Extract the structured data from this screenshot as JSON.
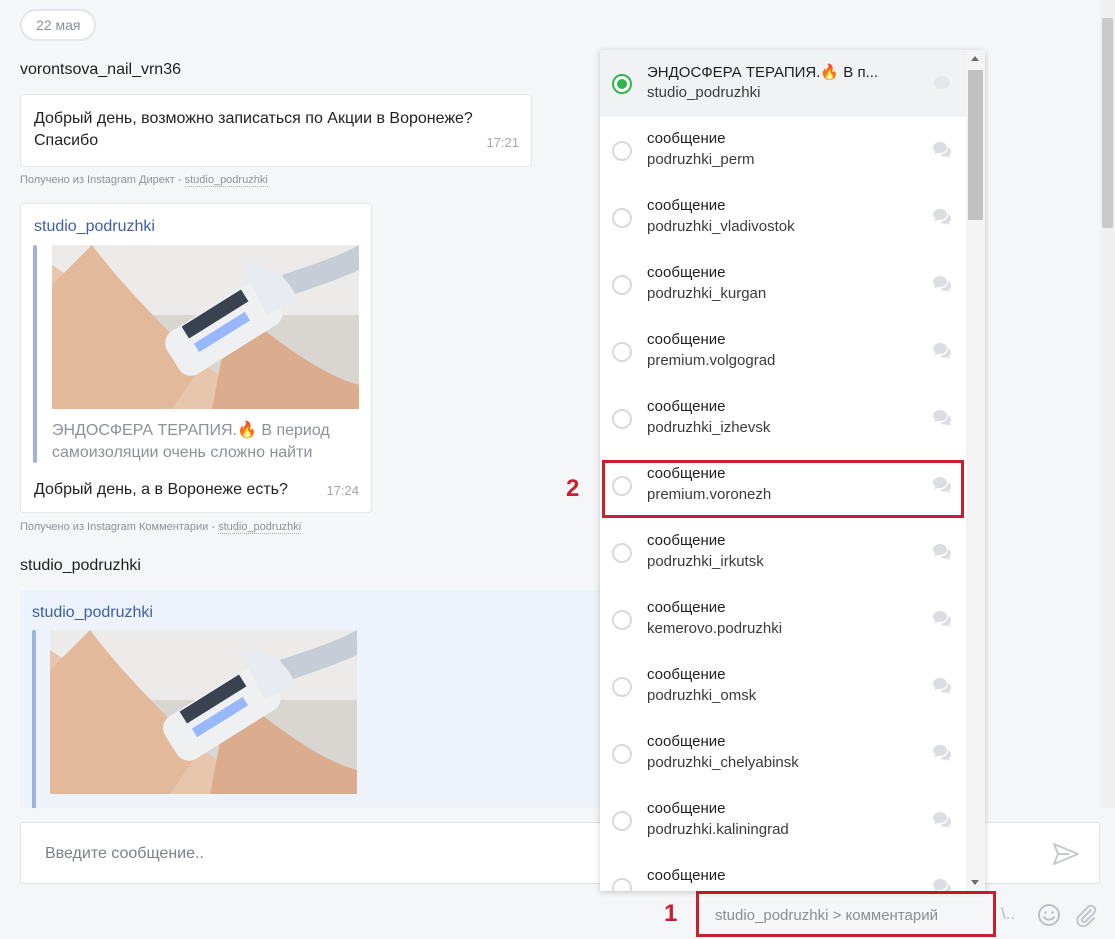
{
  "chat": {
    "date": "22 мая",
    "msg1": {
      "sender": "vorontsova_nail_vrn36",
      "text": "Добрый день, возможно записаться по Акции в Воронеже? Спасибо",
      "time": "17:21",
      "source_prefix": "Получено из Instagram Директ - ",
      "source_channel": "studio_podruzhki"
    },
    "msg2": {
      "quote_author": "studio_podruzhki",
      "quote_text": "ЭНДОСФЕРА ТЕРАПИЯ.🔥 В период самоизоляции очень сложно найти",
      "text": "Добрый день, а в Воронеже есть?",
      "time": "17:24",
      "source_prefix": "Получено из Instagram Комментарии - ",
      "source_channel": "studio_podruzhki"
    },
    "msg3": {
      "sender": "studio_podruzhki",
      "quote_author": "studio_podruzhki"
    }
  },
  "composer": {
    "placeholder": "Введите сообщение.."
  },
  "footer": {
    "channel": "studio_podruzhki > комментарий",
    "annotation": "1"
  },
  "dropdown": {
    "annotation": "2",
    "items": [
      {
        "title": "ЭНДОСФЕРА ТЕРАПИЯ.🔥 В п...",
        "sub": "studio_podruzhki",
        "selected": true
      },
      {
        "title": "сообщение",
        "sub": "podruzhki_perm",
        "selected": false
      },
      {
        "title": "сообщение",
        "sub": "podruzhki_vladivostok",
        "selected": false
      },
      {
        "title": "сообщение",
        "sub": "podruzhki_kurgan",
        "selected": false
      },
      {
        "title": "сообщение",
        "sub": "premium.volgograd",
        "selected": false
      },
      {
        "title": "сообщение",
        "sub": "podruzhki_izhevsk",
        "selected": false
      },
      {
        "title": "сообщение",
        "sub": "premium.voronezh",
        "selected": false
      },
      {
        "title": "сообщение",
        "sub": "podruzhki_irkutsk",
        "selected": false
      },
      {
        "title": "сообщение",
        "sub": "kemerovo.podruzhki",
        "selected": false
      },
      {
        "title": "сообщение",
        "sub": "podruzhki_omsk",
        "selected": false
      },
      {
        "title": "сообщение",
        "sub": "podruzhki_chelyabinsk",
        "selected": false
      },
      {
        "title": "сообщение",
        "sub": "podruzhki.kaliningrad",
        "selected": false
      },
      {
        "title": "сообщение",
        "sub": "",
        "selected": false
      }
    ]
  },
  "colors": {
    "accent_green": "#30b44b",
    "annotation_red": "#cc1f2d",
    "link_blue": "#3d5fa8"
  }
}
